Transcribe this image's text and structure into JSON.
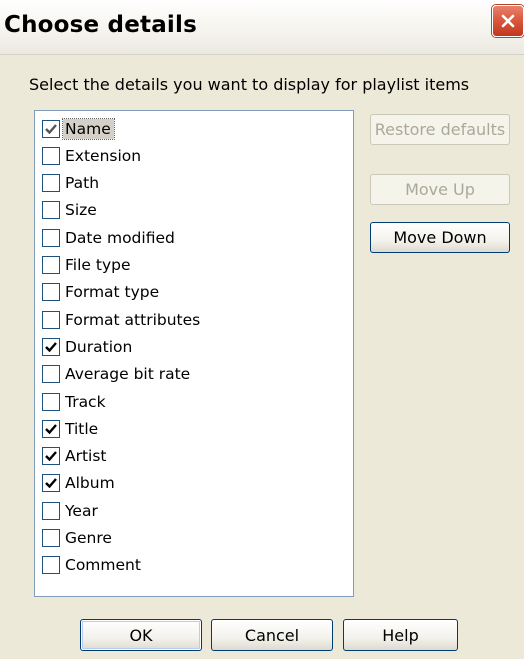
{
  "window": {
    "title": "Choose details"
  },
  "instruction": "Select the details you want to display for playlist items",
  "details": [
    {
      "label": "Name",
      "checked": true,
      "selected": true
    },
    {
      "label": "Extension",
      "checked": false
    },
    {
      "label": "Path",
      "checked": false
    },
    {
      "label": "Size",
      "checked": false
    },
    {
      "label": "Date modified",
      "checked": false
    },
    {
      "label": "File type",
      "checked": false
    },
    {
      "label": "Format type",
      "checked": false
    },
    {
      "label": "Format attributes",
      "checked": false
    },
    {
      "label": "Duration",
      "checked": true
    },
    {
      "label": "Average bit rate",
      "checked": false
    },
    {
      "label": "Track",
      "checked": false
    },
    {
      "label": "Title",
      "checked": true
    },
    {
      "label": "Artist",
      "checked": true
    },
    {
      "label": "Album",
      "checked": true
    },
    {
      "label": "Year",
      "checked": false
    },
    {
      "label": "Genre",
      "checked": false
    },
    {
      "label": "Comment",
      "checked": false
    }
  ],
  "side_buttons": {
    "restore_defaults": "Restore defaults",
    "move_up": "Move Up",
    "move_down": "Move Down"
  },
  "footer_buttons": {
    "ok": "OK",
    "cancel": "Cancel",
    "help": "Help"
  },
  "colors": {
    "dialog_bg": "#ece9d8",
    "close_red": "#d9553c",
    "list_border": "#7f9db9",
    "button_border": "#003c74",
    "disabled_text": "#aca899"
  }
}
